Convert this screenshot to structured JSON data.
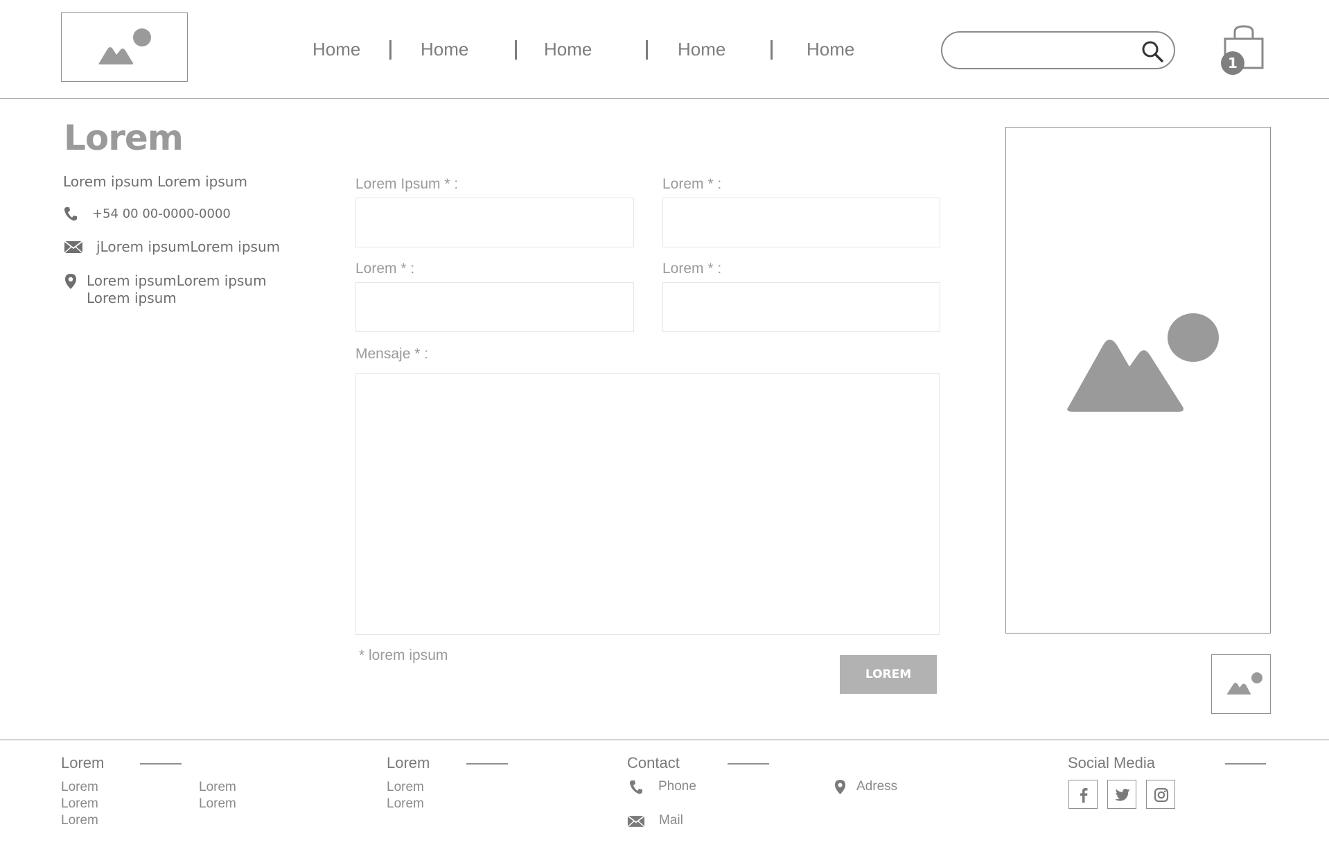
{
  "header": {
    "nav": [
      "Home",
      "Home",
      "Home",
      "Home",
      "Home"
    ],
    "search": {
      "value": "",
      "placeholder": ""
    },
    "cart": {
      "count": "1"
    }
  },
  "contact_info": {
    "title": "Lorem",
    "subtitle": "Lorem ipsum Lorem ipsum",
    "phone": "+54 00 00-0000-0000",
    "email": "jLorem ipsumLorem ipsum",
    "address_line1": "Lorem ipsumLorem ipsum",
    "address_line2": "Lorem ipsum"
  },
  "form": {
    "field1_label": "Lorem Ipsum * :",
    "field2_label": "Lorem * :",
    "field3_label": "Lorem * :",
    "field4_label": "Lorem * :",
    "message_label": "Mensaje * :",
    "note": "* lorem ipsum",
    "submit_label": "LOREM"
  },
  "footer": {
    "col1": {
      "title": "Lorem",
      "links_a": [
        "Lorem",
        "Lorem",
        "Lorem"
      ],
      "links_b": [
        "Lorem",
        "Lorem"
      ]
    },
    "col2": {
      "title": "Lorem",
      "links": [
        "Lorem",
        "Lorem"
      ]
    },
    "contact": {
      "title": "Contact",
      "phone": "Phone",
      "mail": "Mail",
      "address": "Adress"
    },
    "social": {
      "title": "Social Media",
      "icons": [
        "facebook-icon",
        "twitter-icon",
        "instagram-icon"
      ]
    }
  },
  "colors": {
    "wire_gray": "#8f8f8f",
    "placeholder_gray": "#9b9b9b",
    "button_gray": "#b2b2b2"
  }
}
